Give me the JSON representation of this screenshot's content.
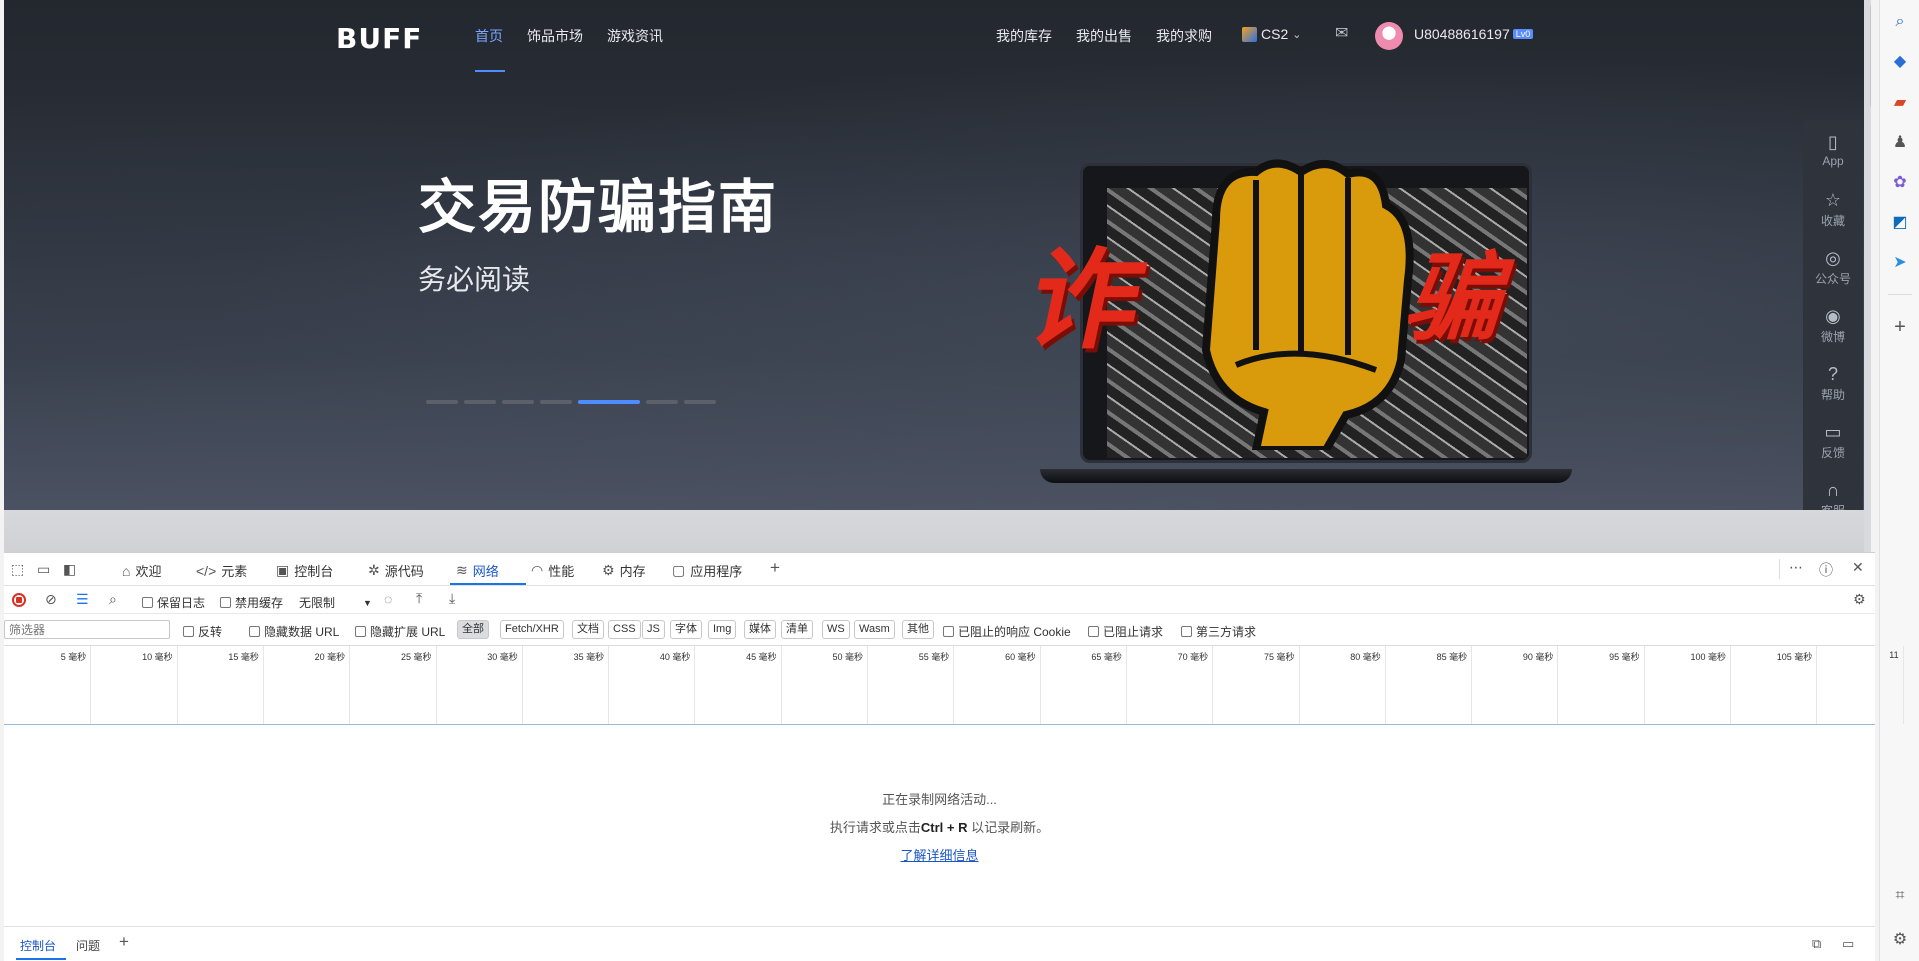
{
  "site": {
    "logo": "BUFF",
    "nav": [
      "首页",
      "饰品市场",
      "游戏资讯"
    ],
    "user_nav": [
      "我的库存",
      "我的出售",
      "我的求购"
    ],
    "game": "CS2",
    "username": "U80488616197",
    "level": "Lv0"
  },
  "hero": {
    "title": "交易防骗指南",
    "subtitle": "务必阅读",
    "red_text_left": "诈",
    "red_text_right": "骗",
    "carousel": {
      "count": 7,
      "active_index": 4
    }
  },
  "page_side": [
    {
      "icon": "tablet-icon",
      "glyph": "▯",
      "label": "App"
    },
    {
      "icon": "star-icon",
      "glyph": "☆",
      "label": "收藏"
    },
    {
      "icon": "wechat-icon",
      "glyph": "◎",
      "label": "公众号"
    },
    {
      "icon": "weibo-icon",
      "glyph": "◉",
      "label": "微博"
    },
    {
      "icon": "help-icon",
      "glyph": "?",
      "label": "帮助"
    },
    {
      "icon": "feedback-icon",
      "glyph": "▭",
      "label": "反馈"
    },
    {
      "icon": "headset-icon",
      "glyph": "∩",
      "label": "客服"
    }
  ],
  "devtools": {
    "tabs": [
      {
        "label": "欢迎",
        "icon": "home-icon",
        "glyph": "⌂"
      },
      {
        "label": "元素",
        "icon": "code-icon",
        "glyph": "</>"
      },
      {
        "label": "控制台",
        "icon": "console-icon",
        "glyph": "▣"
      },
      {
        "label": "源代码",
        "icon": "bug-icon",
        "glyph": "✲"
      },
      {
        "label": "网络",
        "icon": "wifi-icon",
        "glyph": "≋"
      },
      {
        "label": "性能",
        "icon": "gauge-icon",
        "glyph": "◠"
      },
      {
        "label": "内存",
        "icon": "gear-icon",
        "glyph": "⚙"
      },
      {
        "label": "应用程序",
        "icon": "app-icon",
        "glyph": "▢"
      }
    ],
    "toolbar": {
      "preserve_log": "保留日志",
      "disable_cache": "禁用缓存",
      "throttle": "无限制"
    },
    "filter": {
      "placeholder": "筛选器",
      "invert": "反转",
      "hide_data_urls": "隐藏数据 URL",
      "hide_ext_urls": "隐藏扩展 URL",
      "types": [
        "全部",
        "Fetch/XHR",
        "文档",
        "CSS",
        "JS",
        "字体",
        "Img",
        "媒体",
        "清单",
        "WS",
        "Wasm",
        "其他"
      ],
      "blocked_cookies": "已阻止的响应 Cookie",
      "blocked_requests": "已阻止请求",
      "third_party": "第三方请求"
    },
    "timeline_ticks": [
      "5 毫秒",
      "10 毫秒",
      "15 毫秒",
      "20 毫秒",
      "25 毫秒",
      "30 毫秒",
      "35 毫秒",
      "40 毫秒",
      "45 毫秒",
      "50 毫秒",
      "55 毫秒",
      "60 毫秒",
      "65 毫秒",
      "70 毫秒",
      "75 毫秒",
      "80 毫秒",
      "85 毫秒",
      "90 毫秒",
      "95 毫秒",
      "100 毫秒",
      "105 毫秒",
      "11"
    ],
    "empty": {
      "line1": "正在录制网络活动...",
      "line2_pre": "执行请求或点击",
      "line2_key": "Ctrl + R",
      "line2_post": " 以记录刷新。",
      "link": "了解详细信息"
    },
    "drawer_tabs": [
      "控制台",
      "问题"
    ]
  },
  "colors": {
    "accent": "#4f8cff",
    "devtools_accent": "#1a73e8",
    "record": "#d93025"
  }
}
